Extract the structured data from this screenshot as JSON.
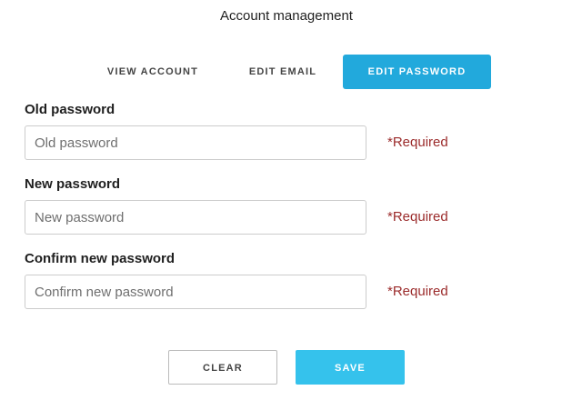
{
  "page": {
    "title": "Account management"
  },
  "tabs": [
    {
      "label": "VIEW ACCOUNT",
      "active": false
    },
    {
      "label": "EDIT EMAIL",
      "active": false
    },
    {
      "label": "EDIT PASSWORD",
      "active": true
    }
  ],
  "form": {
    "old_password": {
      "label": "Old password",
      "placeholder": "Old password",
      "value": "",
      "required_text": "*Required"
    },
    "new_password": {
      "label": "New password",
      "placeholder": "New password",
      "value": "",
      "required_text": "*Required"
    },
    "confirm_password": {
      "label": "Confirm new password",
      "placeholder": "Confirm new password",
      "value": "",
      "required_text": "*Required"
    }
  },
  "buttons": {
    "clear_label": "CLEAR",
    "save_label": "SAVE"
  },
  "colors": {
    "accent": "#22a9dc",
    "save_button": "#35c2ec",
    "required_text": "#9b2b2b"
  }
}
